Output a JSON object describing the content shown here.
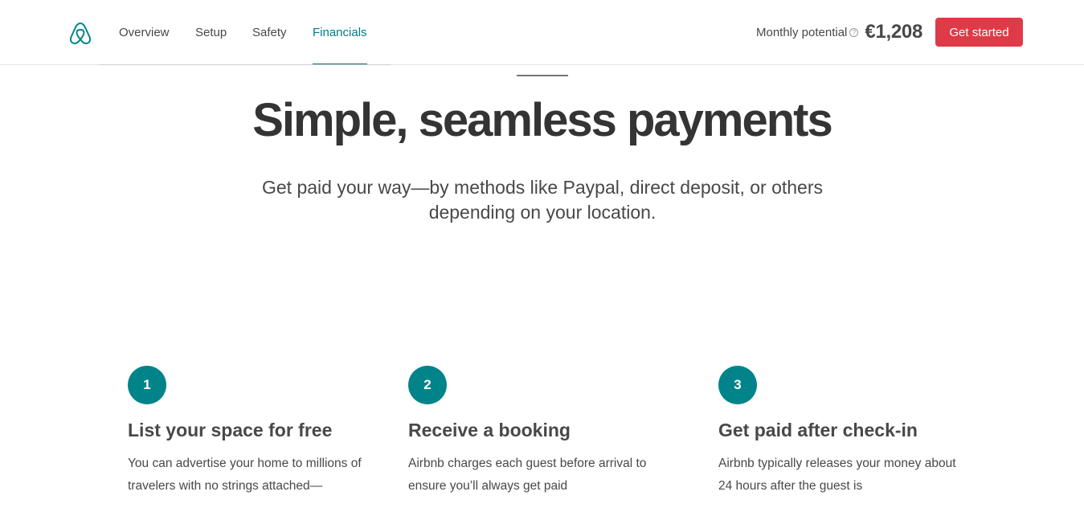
{
  "header": {
    "nav": [
      {
        "label": "Overview",
        "active": false
      },
      {
        "label": "Setup",
        "active": false
      },
      {
        "label": "Safety",
        "active": false
      },
      {
        "label": "Financials",
        "active": true
      }
    ],
    "potential_label": "Monthly potential",
    "help_glyph": "?",
    "potential_amount": "€1,208",
    "cta_label": "Get started"
  },
  "hero": {
    "title": "Simple, seamless payments",
    "subtitle": "Get paid your way—by methods like Paypal, direct deposit, or others depending on your location."
  },
  "steps": [
    {
      "number": "1",
      "title": "List your space for free",
      "text": "You can advertise your home to millions of travelers with no strings attached—"
    },
    {
      "number": "2",
      "title": "Receive a booking",
      "text": "Airbnb charges each guest before arrival to ensure you’ll always get paid"
    },
    {
      "number": "3",
      "title": "Get paid after check-in",
      "text": "Airbnb typically releases your money about 24 hours after the guest is"
    }
  ],
  "colors": {
    "accent": "#008489",
    "cta": "#df3a48",
    "text": "#484848"
  },
  "icons": {
    "logo": "airbnb-logo-icon",
    "help": "help-circle-icon"
  }
}
